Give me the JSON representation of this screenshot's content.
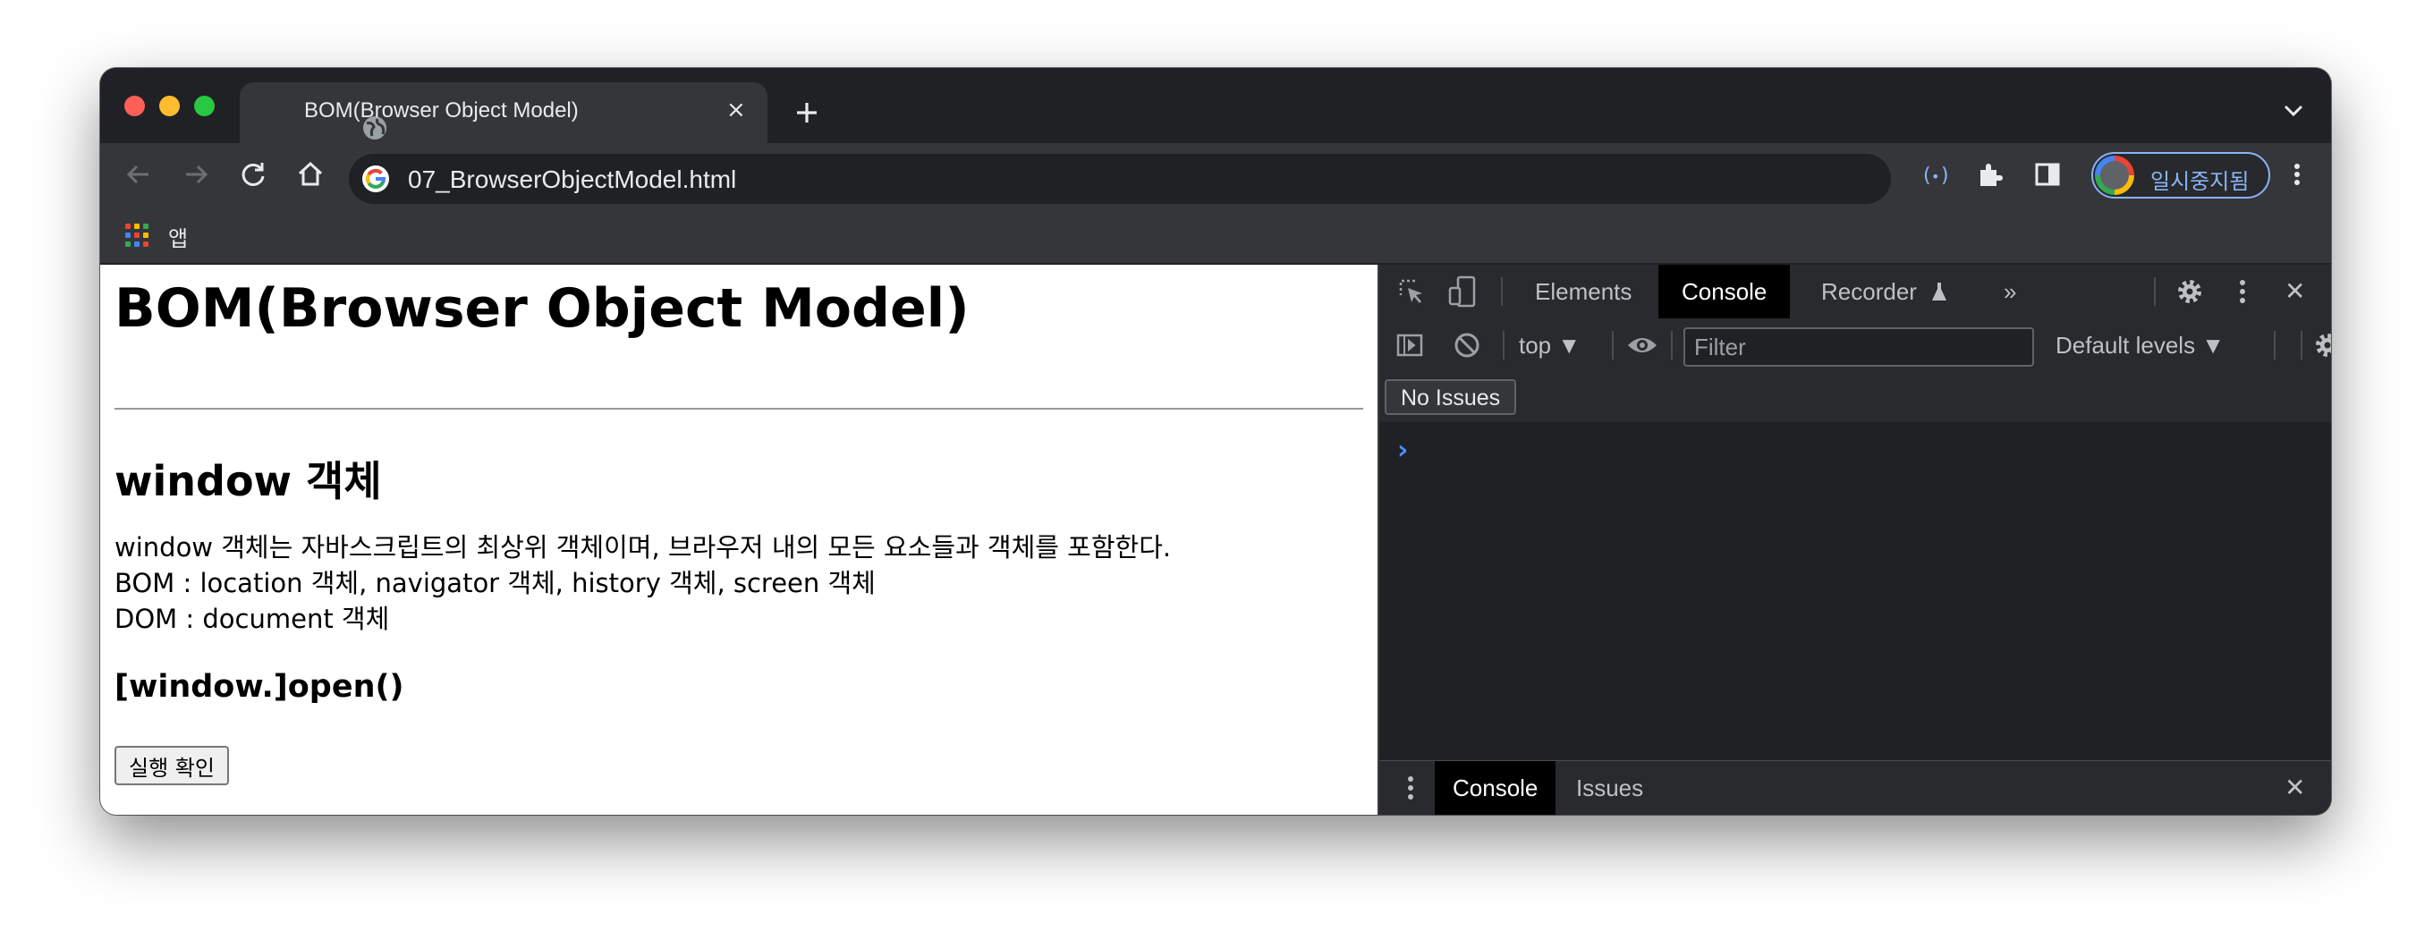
{
  "browser": {
    "tab": {
      "title": "BOM(Browser Object Model)",
      "favicon": "globe-icon",
      "close": "×"
    },
    "new_tab_icon": "plus-icon",
    "address": {
      "url": "07_BrowserObjectModel.html",
      "site_icon": "google-g-icon"
    },
    "profile": {
      "label": "일시중지됨"
    },
    "bookmarks": {
      "apps_label": "앱"
    },
    "colors": {
      "chrome_dark": "#202124",
      "toolbar": "#35363a",
      "accent": "#8ab4f8"
    }
  },
  "page": {
    "h1": "BOM(Browser Object Model)",
    "h2": "window 객체",
    "lines": [
      "window 객체는 자바스크립트의 최상위 객체이며, 브라우저 내의 모든 요소들과 객체를 포함한다.",
      "BOM : location 객체, navigator 객체, history 객체, screen 객체",
      "DOM : document 객체"
    ],
    "h3": "[window.]open()",
    "button": "실행 확인"
  },
  "devtools": {
    "tabs": {
      "elements": "Elements",
      "console": "Console",
      "recorder": "Recorder",
      "more": "»"
    },
    "context": "top ▼",
    "filter_placeholder": "Filter",
    "levels": "Default levels ▼",
    "no_issues": "No Issues",
    "prompt": "›",
    "drawer": {
      "console": "Console",
      "issues": "Issues",
      "close": "✕"
    },
    "close": "✕"
  }
}
